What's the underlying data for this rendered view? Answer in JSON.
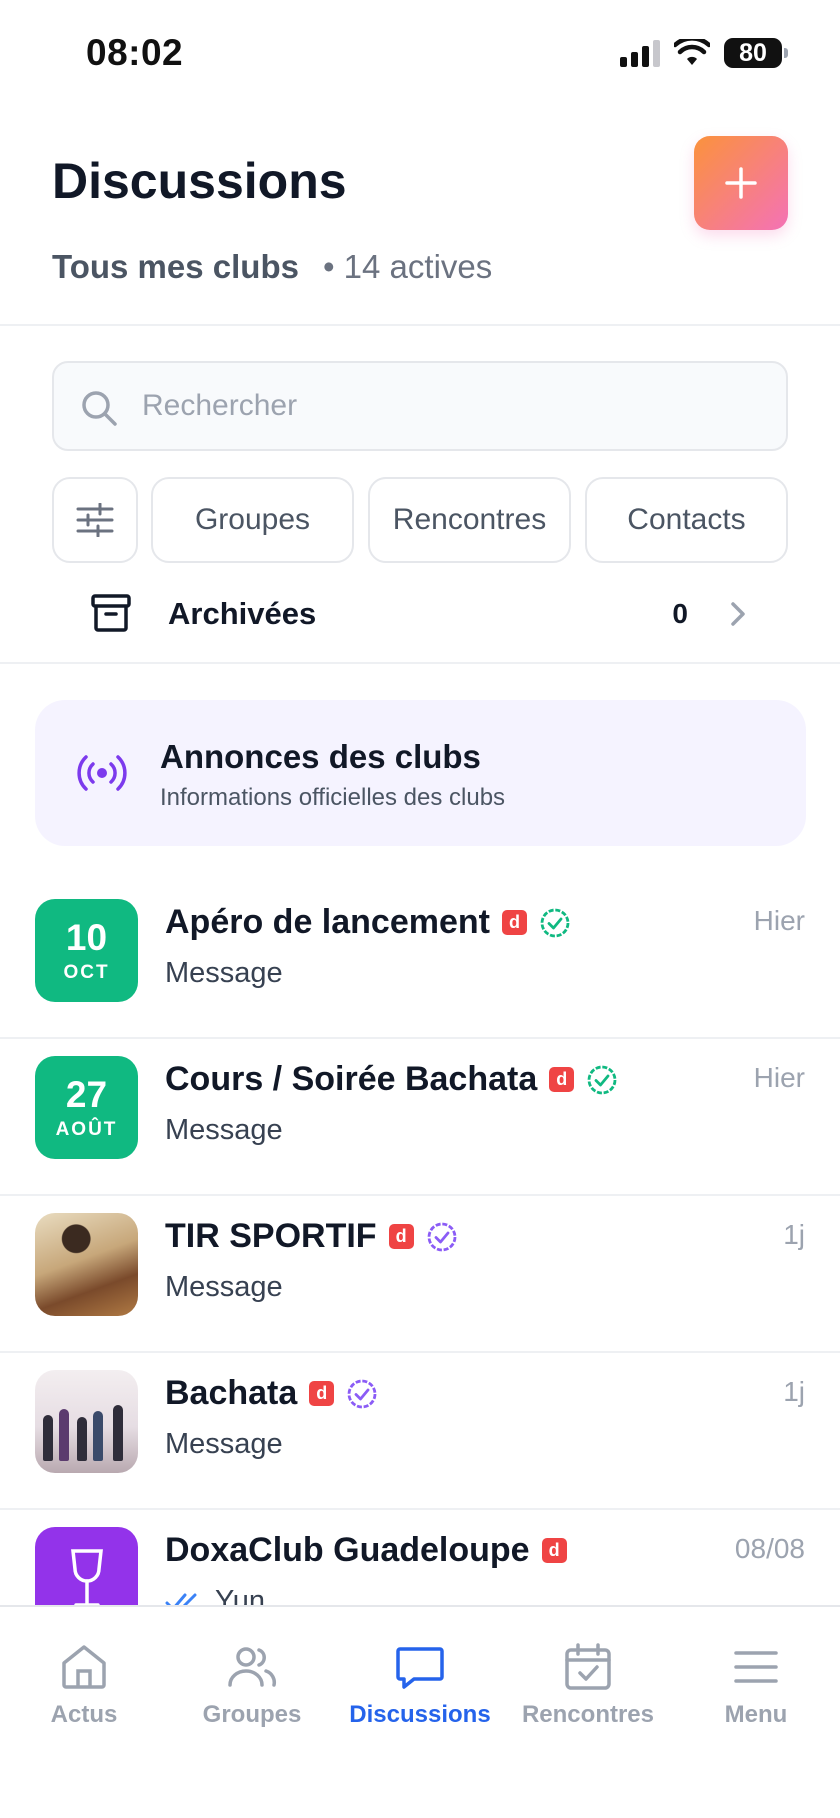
{
  "status_bar": {
    "time": "08:02",
    "battery": "80"
  },
  "header": {
    "title": "Discussions",
    "scope": "Tous mes clubs",
    "count": "• 14 actives",
    "add_icon": "plus-icon"
  },
  "search": {
    "placeholder": "Rechercher",
    "value": ""
  },
  "filters": {
    "groups": "Groupes",
    "meetings": "Rencontres",
    "contacts": "Contacts"
  },
  "archived": {
    "label": "Archivées",
    "count": "0"
  },
  "announcements": {
    "title": "Annonces des clubs",
    "subtitle": "Informations officielles des clubs"
  },
  "conversations": [
    {
      "title": "Apéro de lancement",
      "message": "Message",
      "time": "Hier",
      "avatar_day": "10",
      "avatar_month": "OCT",
      "badge": "d",
      "verified_color": "#10b981"
    },
    {
      "title": "Cours / Soirée Bachata",
      "message": "Message",
      "time": "Hier",
      "avatar_day": "27",
      "avatar_month": "AOÛT",
      "badge": "d",
      "verified_color": "#10b981"
    },
    {
      "title": "TIR SPORTIF",
      "message": "Message",
      "time": "1j",
      "badge": "d",
      "verified_color": "#8b5cf6"
    },
    {
      "title": "Bachata",
      "message": "Message",
      "time": "1j",
      "badge": "d",
      "verified_color": "#8b5cf6"
    },
    {
      "title": "DoxaClub Guadeloupe",
      "message": "Yun",
      "time": "08/08",
      "badge": "d"
    }
  ],
  "nav": {
    "home": "Actus",
    "groups": "Groupes",
    "discussions": "Discussions",
    "meetings": "Rencontres",
    "menu": "Menu"
  },
  "colors": {
    "accent": "#2563eb",
    "date_green": "#10b981",
    "club_purple": "#9333ea",
    "badge_red": "#ef4444"
  }
}
